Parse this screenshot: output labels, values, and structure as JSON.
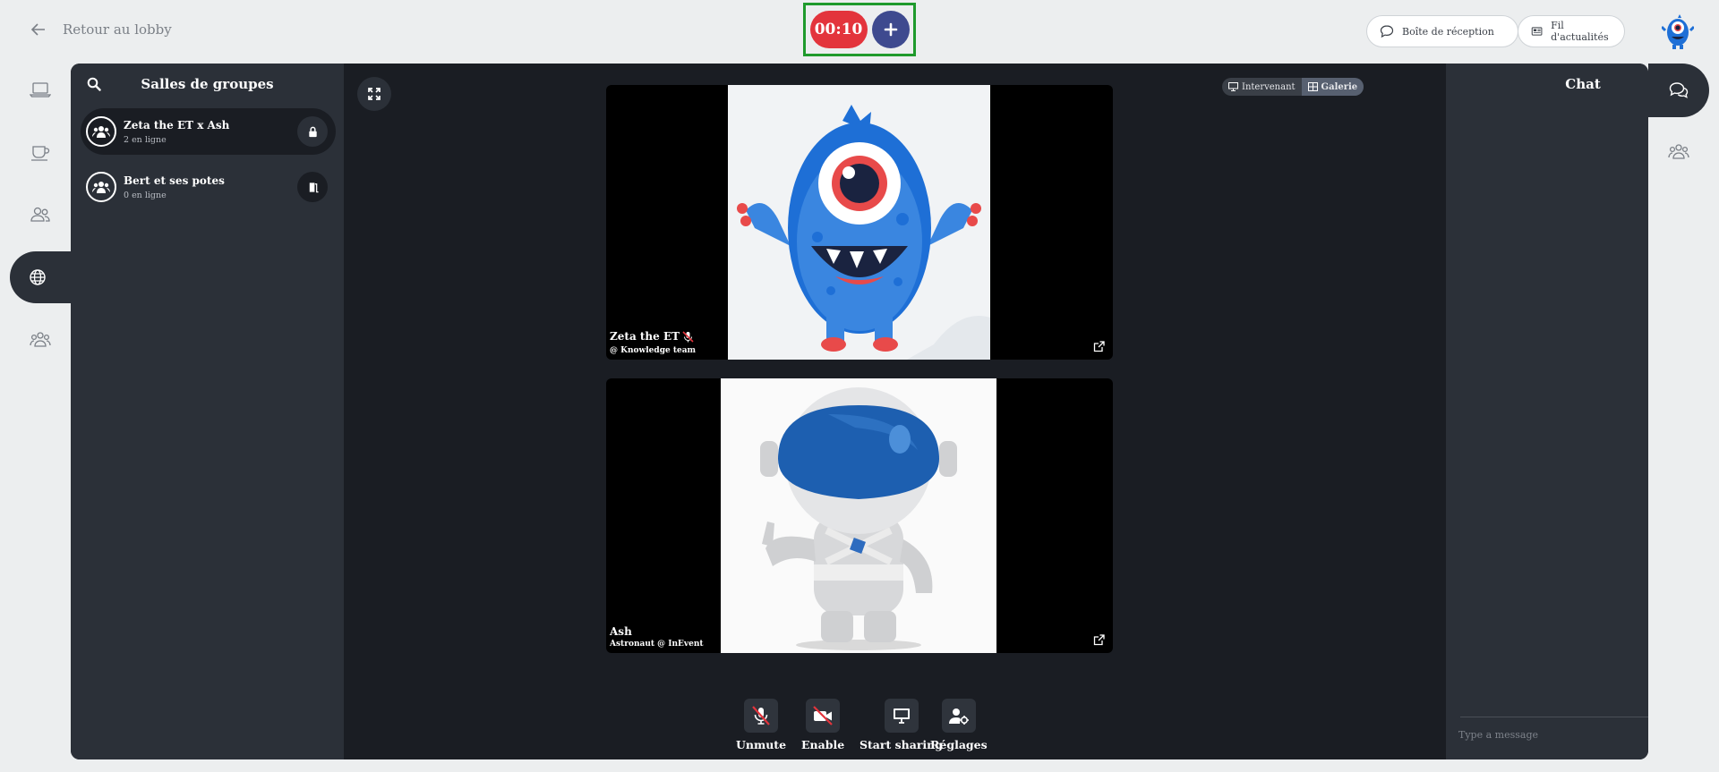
{
  "header": {
    "back_label": "Retour au lobby",
    "timer": "00:10",
    "inbox_label": "Boîte de réception",
    "news_label": "Fil d'actualités"
  },
  "rooms": {
    "title": "Salles de groupes",
    "items": [
      {
        "name": "Zeta the ET x Ash",
        "status": "2 en ligne",
        "active": true
      },
      {
        "name": "Bert et ses potes",
        "status": "0 en ligne",
        "active": false
      }
    ]
  },
  "stage": {
    "view_speaker": "Intervenant",
    "view_gallery": "Galerie",
    "participants": [
      {
        "name": "Zeta the ET",
        "role": "@ Knowledge team",
        "muted": true
      },
      {
        "name": "Ash",
        "role": "Astronaut @ InEvent",
        "muted": false
      }
    ]
  },
  "controls": {
    "unmute": "Unmute",
    "enable": "Enable",
    "share": "Start sharing",
    "settings": "Réglages"
  },
  "chat": {
    "title": "Chat",
    "placeholder": "Type a message"
  },
  "colors": {
    "timer_red": "#e3343c",
    "plus_blue": "#3e4a8f",
    "panel_dark": "#1a1d23",
    "sidebar_dark": "#2b3038",
    "highlight_green": "#1f9a2c"
  }
}
